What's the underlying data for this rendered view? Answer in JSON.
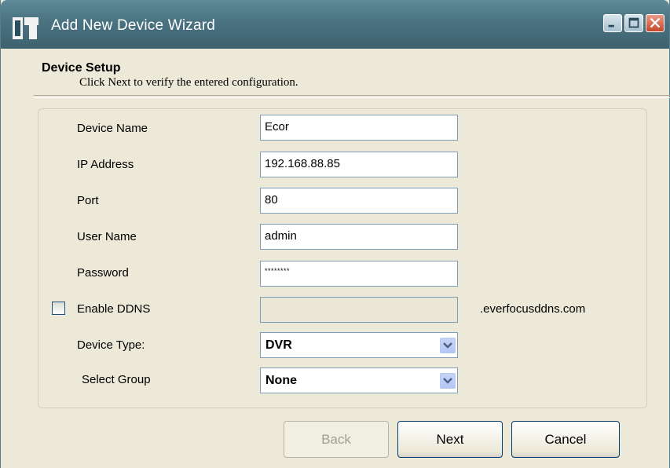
{
  "window": {
    "title": "Add New Device Wizard",
    "controls": {
      "minimize": "minimize",
      "maximize": "maximize",
      "close": "close"
    }
  },
  "header": {
    "title": "Device Setup",
    "subtitle": "Click Next to verify the entered configuration."
  },
  "form": {
    "device_name": {
      "label": "Device Name",
      "value": "Ecor"
    },
    "ip_address": {
      "label": "IP Address",
      "value": "192.168.88.85"
    },
    "port": {
      "label": "Port",
      "value": "80"
    },
    "user_name": {
      "label": "User Name",
      "value": "admin"
    },
    "password": {
      "label": "Password",
      "value": "********"
    },
    "enable_ddns": {
      "label": "Enable DDNS",
      "checked": false,
      "value": "",
      "suffix": ".everfocusddns.com"
    },
    "device_type": {
      "label": "Device Type:",
      "value": "DVR"
    },
    "select_group": {
      "label": "Select Group",
      "value": "None"
    }
  },
  "buttons": {
    "back": "Back",
    "next": "Next",
    "cancel": "Cancel"
  },
  "colors": {
    "titlebar": "#4a7280",
    "window_bg": "#ece9d8",
    "field_border": "#7f9db9"
  }
}
